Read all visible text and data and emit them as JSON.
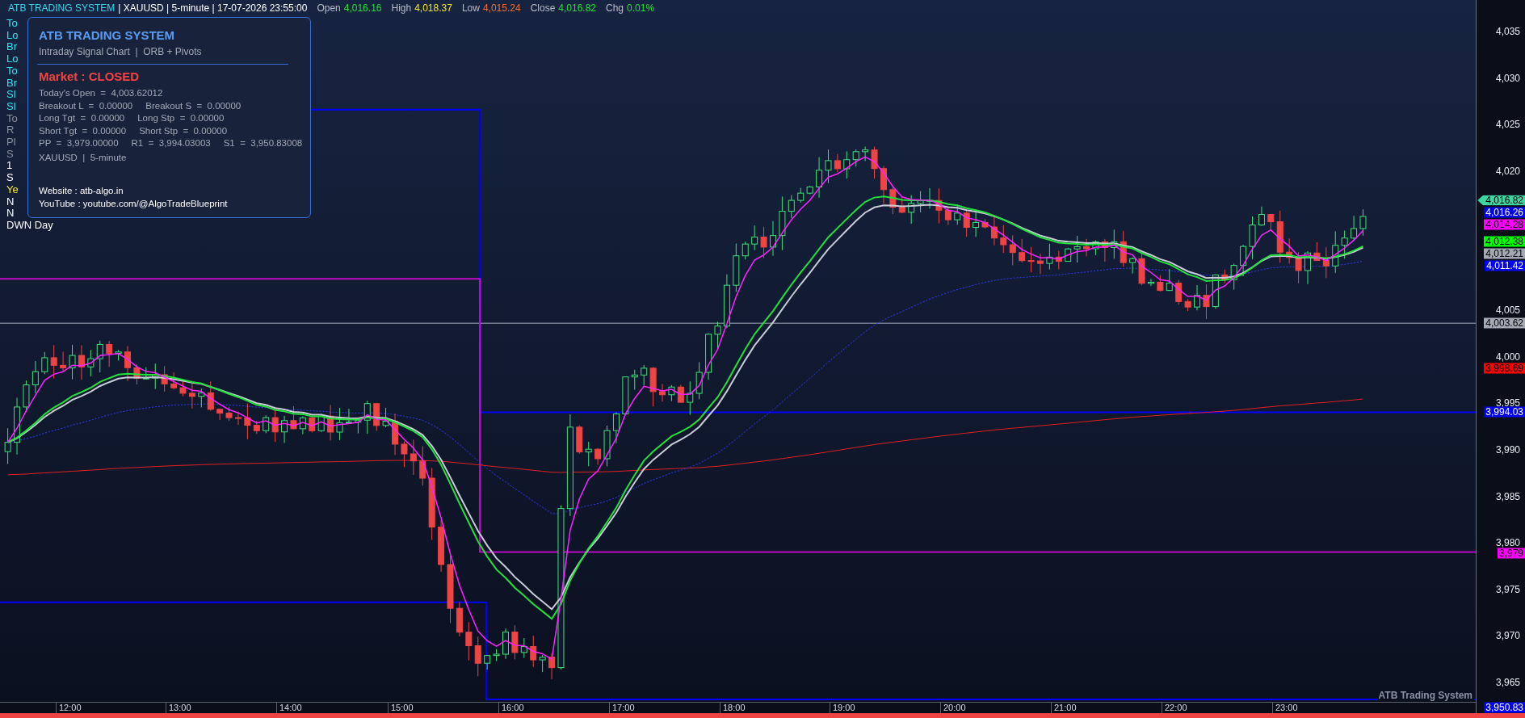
{
  "header": {
    "title": "ATB TRADING SYSTEM",
    "details": "| XAUUSD | 5-minute | 17-07-2026 23:55:00",
    "quotes": [
      {
        "label": "Open",
        "value": "4,016.16",
        "color": "#22e03a"
      },
      {
        "label": "High",
        "value": "4,018.37",
        "color": "#f5e52a"
      },
      {
        "label": "Low",
        "value": "4,015.24",
        "color": "#f2703a"
      },
      {
        "label": "Close",
        "value": "4,016.82",
        "color": "#22e03a"
      },
      {
        "label": "Chg",
        "value": "0.01%",
        "color": "#22e03a"
      }
    ]
  },
  "side_labels": [
    {
      "text": "To",
      "color": "#2ee6f0"
    },
    {
      "text": "Lo",
      "color": "#2ee6f0"
    },
    {
      "text": "Br",
      "color": "#2ee6f0"
    },
    {
      "text": "Lo",
      "color": "#2ee6f0"
    },
    {
      "text": "To",
      "color": "#2ee6f0"
    },
    {
      "text": "Br",
      "color": "#2ee6f0"
    },
    {
      "text": "Sl",
      "color": "#2ee6f0"
    },
    {
      "text": "Sl",
      "color": "#2ee6f0"
    },
    {
      "text": "To",
      "color": "#8a909c"
    },
    {
      "text": "R",
      "color": "#8a909c"
    },
    {
      "text": "Pl",
      "color": "#8a909c"
    },
    {
      "text": "S",
      "color": "#8a909c"
    },
    {
      "text": "1",
      "color": "#ffffff"
    },
    {
      "text": "S",
      "color": "#ffffff"
    },
    {
      "text": "Ye",
      "color": "#f5e52a"
    },
    {
      "text": "N",
      "color": "#ffffff"
    },
    {
      "text": "N",
      "color": "#ffffff"
    },
    {
      "text": "DWN Day",
      "color": "#ffffff"
    }
  ],
  "info_panel": {
    "title": "ATB TRADING SYSTEM",
    "subtitle": "Intraday Signal Chart  |  ORB + Pivots",
    "status": "Market : CLOSED",
    "stats": [
      "Today's Open  =  4,003.62012",
      "Breakout L  =  0.00000     Breakout S  =  0.00000",
      "Long Tgt  =  0.00000     Long Stp  =  0.00000",
      "Short Tgt  =  0.00000     Short Stp  =  0.00000",
      "PP  =  3,979.00000     R1  =  3,994.03003     S1  =  3,950.83008"
    ],
    "symbol": "XAUUSD  |  5-minute",
    "links": [
      "Website : atb-algo.in",
      "YouTube : youtube.com/@AlgoTradeBlueprint"
    ]
  },
  "price_axis": {
    "ticks": [
      "4,035",
      "4,030",
      "4,025",
      "4,020",
      "4,005",
      "4,000",
      "3,995",
      "3,990",
      "3,985",
      "3,980",
      "3,975",
      "3,970",
      "3,965"
    ],
    "tags": [
      {
        "text": "4,016.82",
        "color": "#3dd6a0",
        "kind": "last-price"
      },
      {
        "text": "4,016.26",
        "color": "#0000ff",
        "kind": "level"
      },
      {
        "text": "4,014.28",
        "color": "#ff00ff",
        "kind": "level"
      },
      {
        "text": "4,012.38",
        "color": "#00ff00",
        "kind": "level"
      },
      {
        "text": "4,012.21",
        "color": "#a3a9b5",
        "kind": "level"
      },
      {
        "text": "4,011.42",
        "color": "#0000ff",
        "kind": "level"
      },
      {
        "text": "4,003.62",
        "color": "#a3a9b5",
        "kind": "level"
      },
      {
        "text": "3,998.69",
        "color": "#ff0000",
        "kind": "level"
      },
      {
        "text": "3,994.03",
        "color": "#0000ff",
        "kind": "level"
      },
      {
        "text": "3,979",
        "color": "#ff00ff",
        "kind": "level"
      },
      {
        "text": "3,950.83",
        "color": "#0000ff",
        "kind": "level"
      }
    ]
  },
  "time_axis": {
    "labels": [
      "12:00",
      "13:00",
      "14:00",
      "15:00",
      "16:00",
      "17:00",
      "18:00",
      "19:00",
      "20:00",
      "21:00",
      "22:00",
      "23:00"
    ]
  },
  "footer": {
    "brand": "ATB Trading System"
  }
}
